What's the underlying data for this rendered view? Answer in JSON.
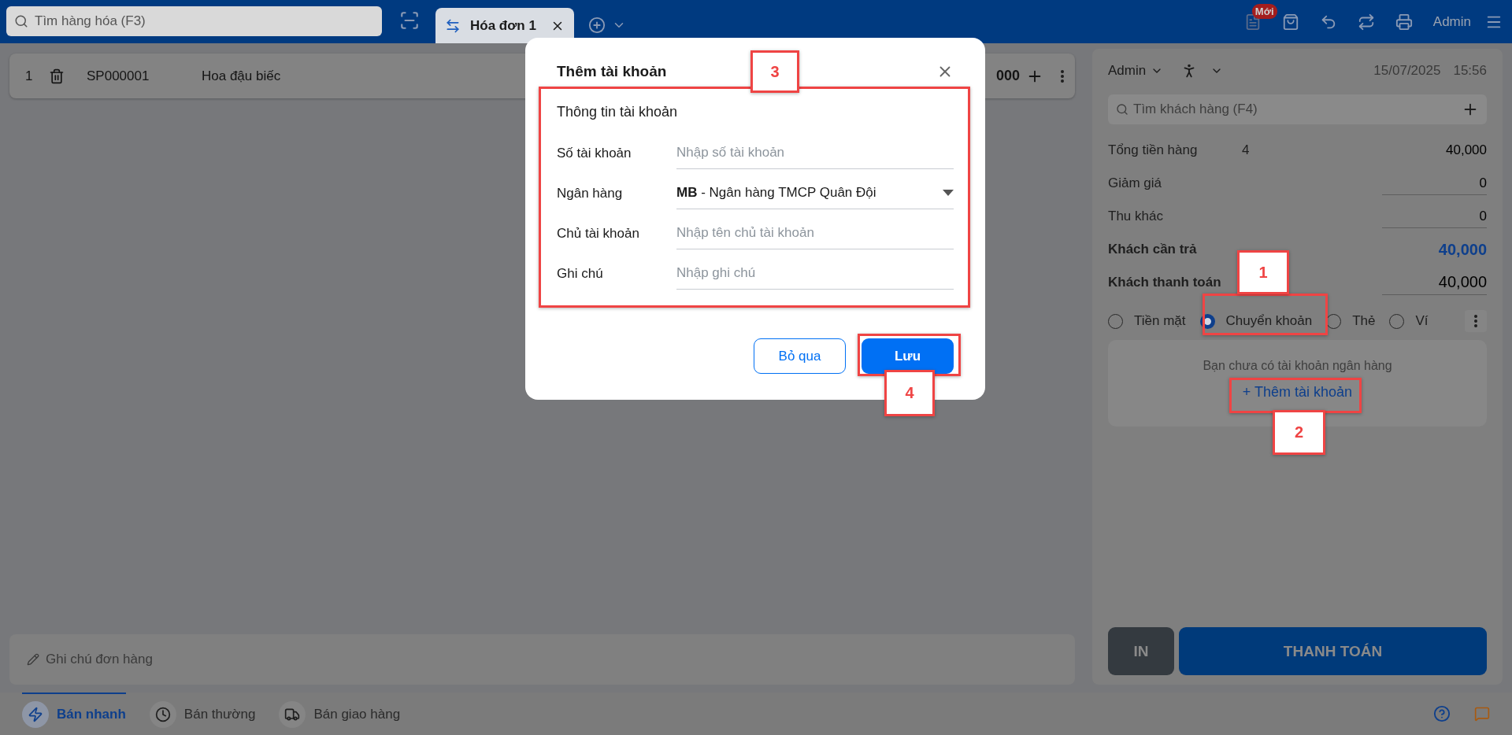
{
  "header": {
    "search": {
      "placeholder": "Tìm hàng hóa (F3)"
    },
    "tabs": [
      {
        "label": "Hóa đơn 1",
        "selected": true
      }
    ],
    "badge": "Mới",
    "user": "Admin"
  },
  "cart": {
    "rows": [
      {
        "index": "1",
        "code": "SP000001",
        "name": "Hoa đậu biếc",
        "amount": "000"
      }
    ]
  },
  "order_note": {
    "placeholder": "Ghi chú đơn hàng"
  },
  "checkout": {
    "seller": "Admin",
    "date": "15/07/2025",
    "time": "15:56",
    "customer_search": {
      "placeholder": "Tìm khách hàng (F4)"
    },
    "summary": [
      {
        "label": "Tổng tiền hàng",
        "count": "4",
        "value": "40,000",
        "kind": "plain"
      },
      {
        "label": "Giảm giá",
        "value": "0",
        "kind": "input"
      },
      {
        "label": "Thu khác",
        "value": "0",
        "kind": "input"
      },
      {
        "label": "Khách cần trả",
        "value": "40,000",
        "kind": "total"
      },
      {
        "label": "Khách thanh toán",
        "value": "40,000",
        "kind": "paid"
      }
    ],
    "payment_methods": [
      {
        "label": "Tiền mặt",
        "selected": false
      },
      {
        "label": "Chuyển khoản",
        "selected": true
      },
      {
        "label": "Thẻ",
        "selected": false
      },
      {
        "label": "Ví",
        "selected": false
      }
    ],
    "bank_notice": "Bạn chưa có tài khoản ngân hàng",
    "add_account": "+ Thêm tài khoản",
    "buttons": {
      "print": "IN",
      "pay": "THANH TOÁN"
    }
  },
  "bottom_nav": [
    {
      "label": "Bán nhanh",
      "selected": true
    },
    {
      "label": "Bán thường",
      "selected": false
    },
    {
      "label": "Bán giao hàng",
      "selected": false
    }
  ],
  "dialog": {
    "title": "Thêm tài khoản",
    "section": "Thông tin tài khoản",
    "fields": [
      {
        "label": "Số tài khoản",
        "placeholder": "Nhập số tài khoản",
        "kind": "input"
      },
      {
        "label": "Ngân hàng",
        "value": "**MB** - Ngân hàng TMCP Quân Đội",
        "kind": "select"
      },
      {
        "label": "Chủ tài khoản",
        "placeholder": "Nhập tên chủ tài khoản",
        "kind": "input"
      },
      {
        "label": "Ghi chú",
        "placeholder": "Nhập ghi chú",
        "kind": "input"
      }
    ],
    "buttons": {
      "cancel": "Bỏ qua",
      "save": "Lưu"
    }
  },
  "annotations": [
    {
      "label": "1"
    },
    {
      "label": "2"
    },
    {
      "label": "3"
    },
    {
      "label": "4"
    }
  ]
}
